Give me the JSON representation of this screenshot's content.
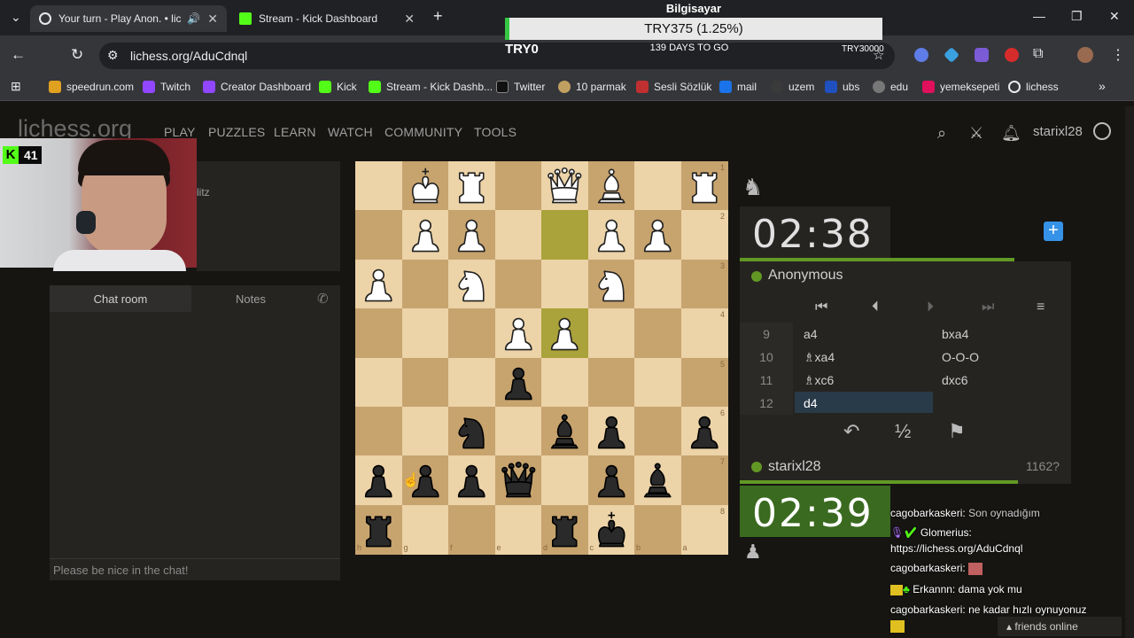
{
  "browser": {
    "tabs": [
      {
        "label": "Your turn - Play Anon. • lich",
        "active": true
      },
      {
        "label": "Stream - Kick Dashboard",
        "active": false
      }
    ],
    "new_tab": "+",
    "url": "lichess.org/AduCdnql",
    "bookmarks": [
      "speedrun.com",
      "Twitch",
      "Creator Dashboard",
      "Kick",
      "Stream - Kick Dashb...",
      "Twitter",
      "10 parmak",
      "Sesli Sözlük",
      "mail",
      "uzem",
      "ubs",
      "edu",
      "yemeksepeti",
      "lichess"
    ]
  },
  "overlay": {
    "title": "Bilgisayar",
    "progress_text": "TRY375 (1.25%)",
    "progress_percent": 1.25,
    "left": "TRY0",
    "middle": "139 DAYS TO GO",
    "right": "TRY30000"
  },
  "stream": {
    "viewers": "41",
    "kick_letter": "K"
  },
  "lichess": {
    "logo": "lichess.org",
    "nav": [
      "PLAY",
      "PUZZLES",
      "LEARN",
      "WATCH",
      "COMMUNITY",
      "TOOLS"
    ],
    "username": "starixl28",
    "blitz_fragment": "litz"
  },
  "chat_panel": {
    "tab_chat": "Chat room",
    "tab_notes": "Notes",
    "placeholder": "Please be nice in the chat!"
  },
  "board": {
    "coords_rank": [
      "1",
      "2",
      "3",
      "4",
      "5",
      "6",
      "7",
      "8"
    ],
    "coords_file": [
      "h",
      "g",
      "f",
      "e",
      "d",
      "c",
      "b",
      "a"
    ],
    "highlight": [
      [
        4,
        1
      ],
      [
        4,
        3
      ]
    ],
    "pieces": [
      {
        "t": "K",
        "c": "w",
        "col": 1,
        "row": 0
      },
      {
        "t": "R",
        "c": "w",
        "col": 2,
        "row": 0
      },
      {
        "t": "Q",
        "c": "w",
        "col": 4,
        "row": 0
      },
      {
        "t": "B",
        "c": "w",
        "col": 5,
        "row": 0
      },
      {
        "t": "R",
        "c": "w",
        "col": 7,
        "row": 0
      },
      {
        "t": "P",
        "c": "w",
        "col": 1,
        "row": 1
      },
      {
        "t": "P",
        "c": "w",
        "col": 2,
        "row": 1
      },
      {
        "t": "P",
        "c": "w",
        "col": 5,
        "row": 1
      },
      {
        "t": "P",
        "c": "w",
        "col": 6,
        "row": 1
      },
      {
        "t": "P",
        "c": "w",
        "col": 0,
        "row": 2
      },
      {
        "t": "N",
        "c": "w",
        "col": 2,
        "row": 2
      },
      {
        "t": "N",
        "c": "w",
        "col": 5,
        "row": 2
      },
      {
        "t": "P",
        "c": "w",
        "col": 3,
        "row": 3
      },
      {
        "t": "P",
        "c": "w",
        "col": 4,
        "row": 3
      },
      {
        "t": "P",
        "c": "b",
        "col": 3,
        "row": 4
      },
      {
        "t": "N",
        "c": "b",
        "col": 2,
        "row": 5
      },
      {
        "t": "B",
        "c": "b",
        "col": 4,
        "row": 5
      },
      {
        "t": "P",
        "c": "b",
        "col": 5,
        "row": 5
      },
      {
        "t": "P",
        "c": "b",
        "col": 7,
        "row": 5
      },
      {
        "t": "P",
        "c": "b",
        "col": 0,
        "row": 6
      },
      {
        "t": "P",
        "c": "b",
        "col": 1,
        "row": 6
      },
      {
        "t": "P",
        "c": "b",
        "col": 2,
        "row": 6
      },
      {
        "t": "Q",
        "c": "b",
        "col": 3,
        "row": 6
      },
      {
        "t": "P",
        "c": "b",
        "col": 5,
        "row": 6
      },
      {
        "t": "B",
        "c": "b",
        "col": 6,
        "row": 6
      },
      {
        "t": "R",
        "c": "b",
        "col": 0,
        "row": 7
      },
      {
        "t": "R",
        "c": "b",
        "col": 4,
        "row": 7
      },
      {
        "t": "K",
        "c": "b",
        "col": 5,
        "row": 7
      }
    ]
  },
  "game": {
    "opponent_clock": "02:38",
    "opponent_name": "Anonymous",
    "player_clock": "02:39",
    "player_name": "starixl28",
    "player_rating": "1162?",
    "opponent_time_fraction": 0.94,
    "player_time_fraction": 0.95,
    "moves": [
      {
        "num": "9",
        "white": "a4",
        "black": "bxa4"
      },
      {
        "num": "10",
        "white": "♗xa4",
        "black": "O-O-O"
      },
      {
        "num": "11",
        "white": "♗xc6",
        "black": "dxc6"
      },
      {
        "num": "12",
        "white": "d4",
        "black": ""
      }
    ],
    "draw_symbol": "½"
  },
  "chat_overlay": [
    {
      "user": "cagobarkaskeri:",
      "msg": "Son oynadığım"
    },
    {
      "user": "Glomerius:",
      "msg": ""
    },
    {
      "user": "",
      "msg": "https://lichess.org/AduCdnql"
    },
    {
      "user": "cagobarkaskeri:",
      "msg": ""
    },
    {
      "user": "Erkannn:",
      "msg": "dama yok mu"
    },
    {
      "user": "cagobarkaskeri:",
      "msg": "ne kadar hızlı oynuyonuz"
    }
  ],
  "friends": "friends online"
}
